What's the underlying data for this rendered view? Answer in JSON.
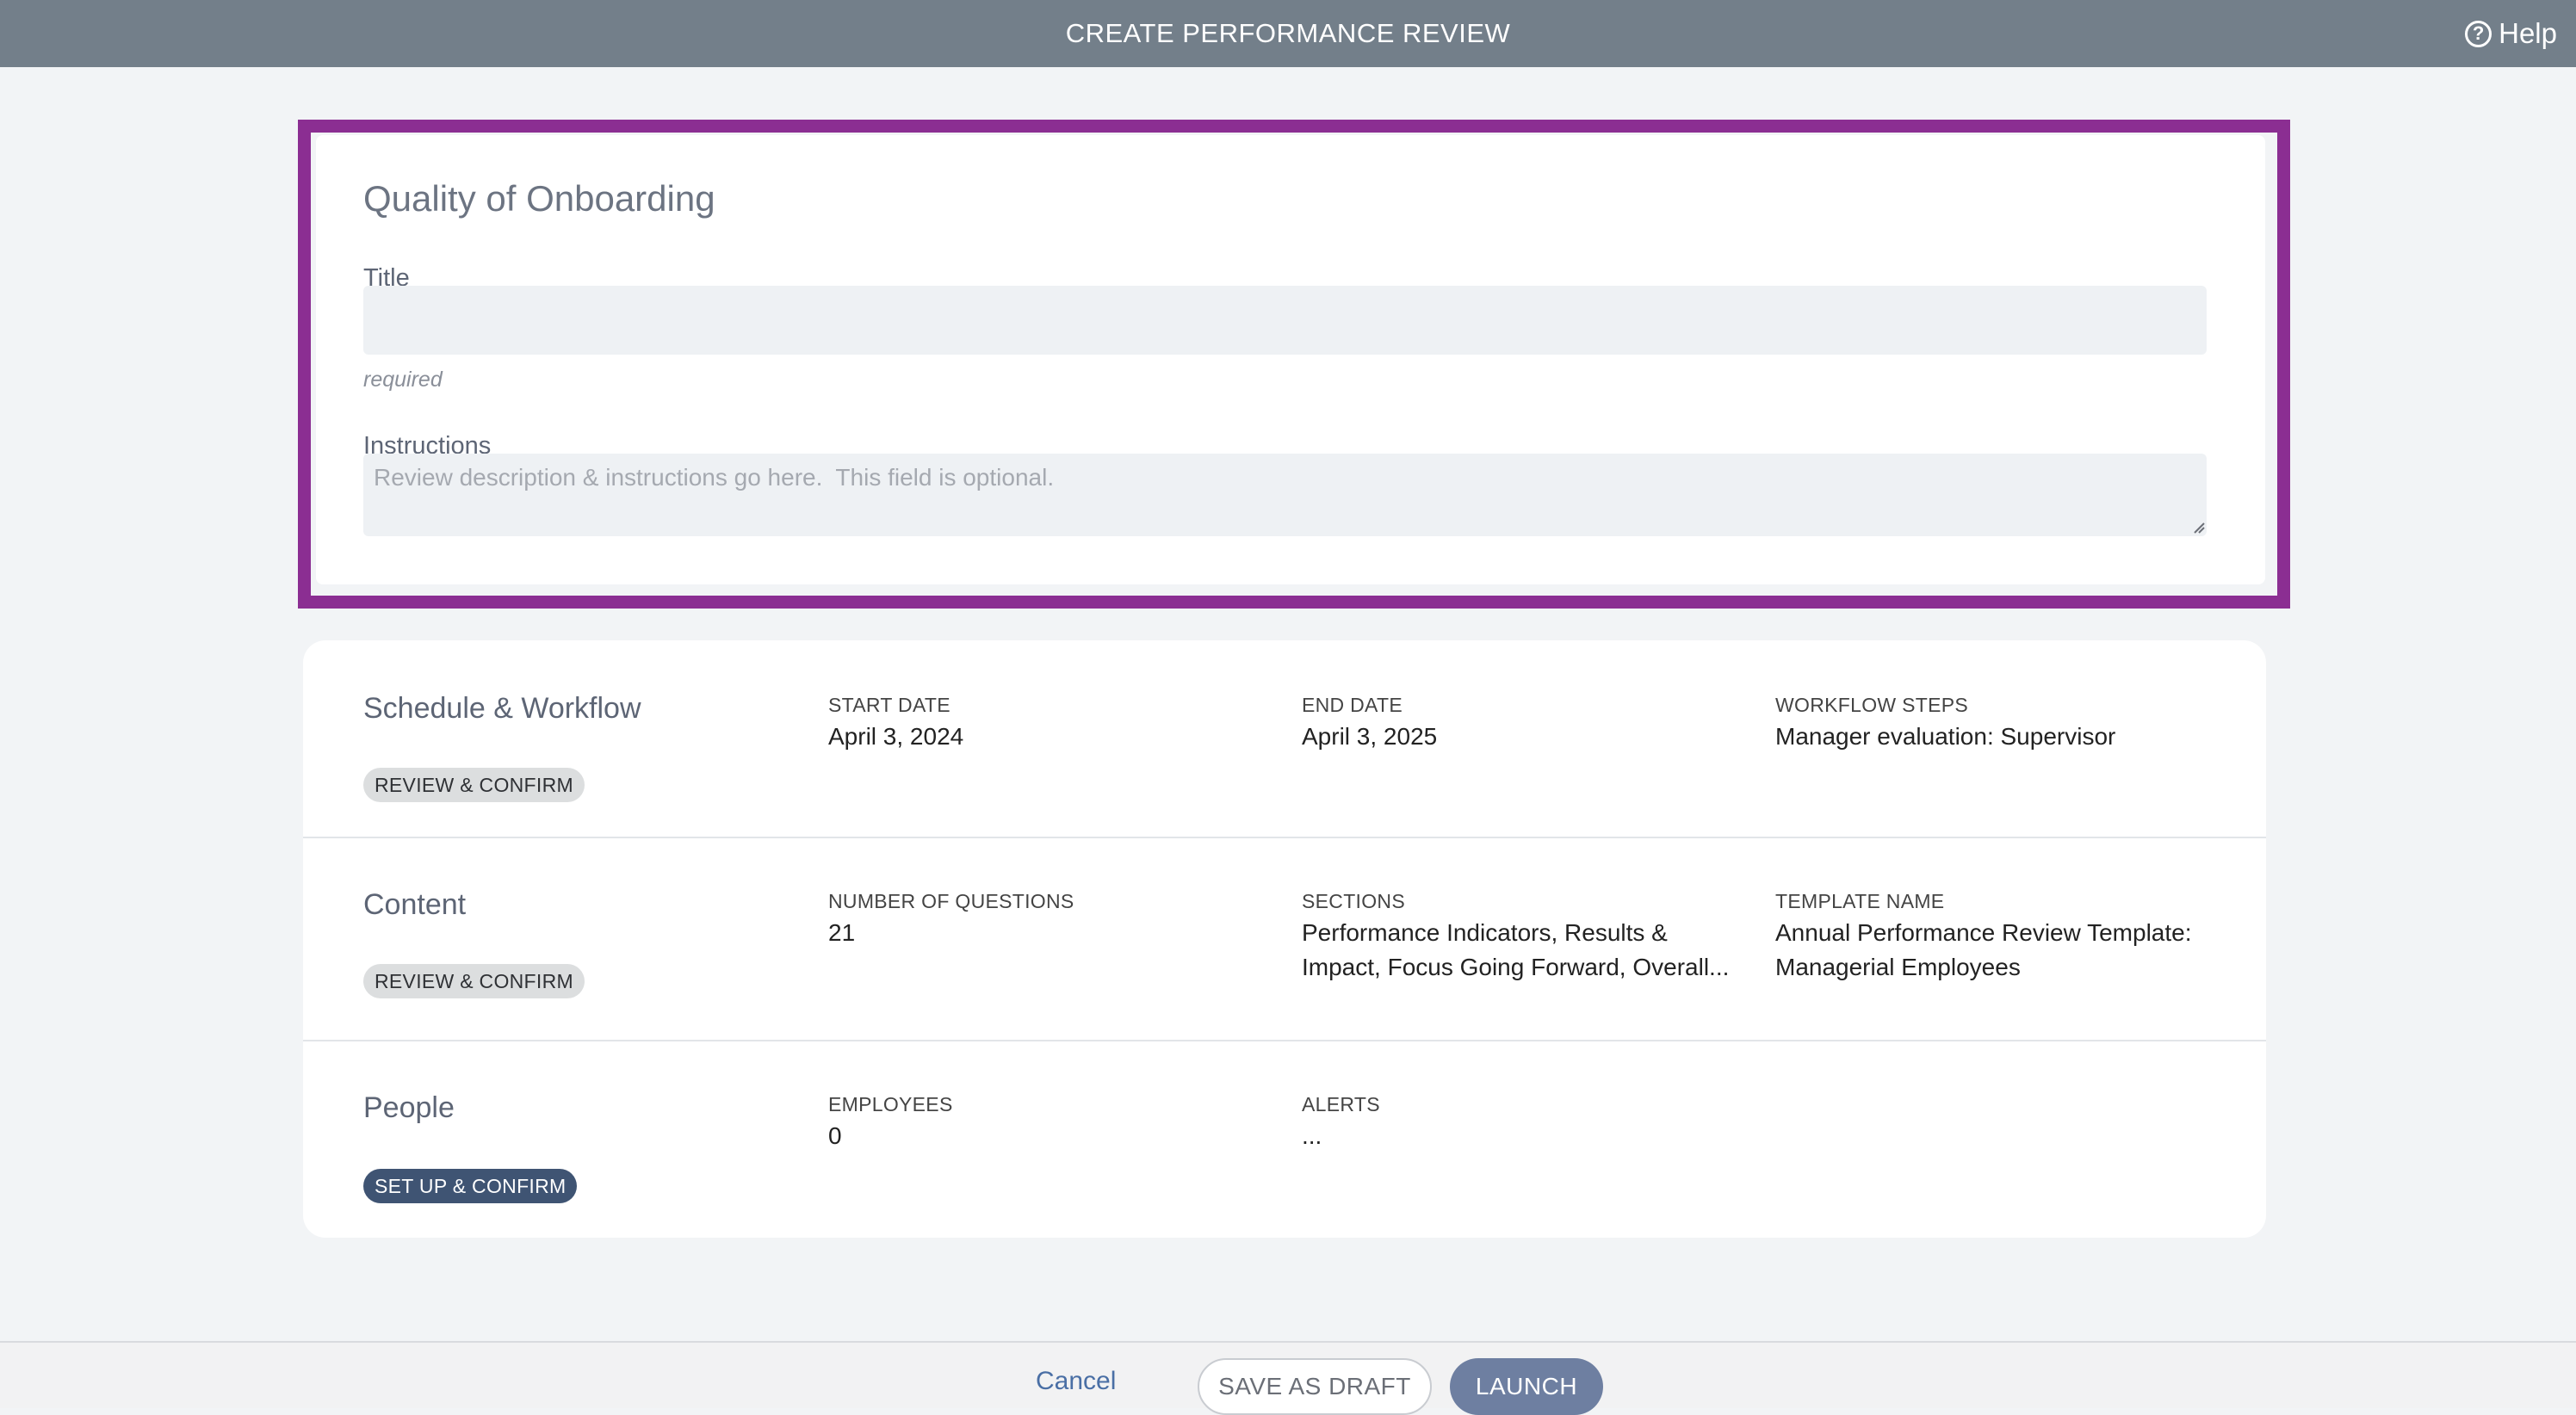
{
  "header": {
    "title": "CREATE PERFORMANCE REVIEW",
    "help_label": "Help",
    "help_icon": "question-circle-icon"
  },
  "review_form": {
    "heading": "Quality of Onboarding",
    "title_label": "Title",
    "title_value": "",
    "title_hint": "required",
    "instructions_label": "Instructions",
    "instructions_placeholder": "Review description & instructions go here.  This field is optional.",
    "highlight_color": "#8b2e92"
  },
  "sections": {
    "schedule": {
      "title": "Schedule & Workflow",
      "action": "REVIEW & CONFIRM",
      "start_date_label": "START DATE",
      "start_date": "April 3, 2024",
      "end_date_label": "END DATE",
      "end_date": "April 3, 2025",
      "workflow_label": "WORKFLOW STEPS",
      "workflow": "Manager evaluation: Supervisor"
    },
    "content": {
      "title": "Content",
      "action": "REVIEW & CONFIRM",
      "questions_label": "NUMBER OF QUESTIONS",
      "questions": "21",
      "sections_label": "SECTIONS",
      "sections_line1": "Performance Indicators, Results &",
      "sections_line2": "Impact, Focus Going Forward, Overall...",
      "template_label": "TEMPLATE NAME",
      "template_line1": "Annual Performance Review Template:",
      "template_line2": "Managerial Employees"
    },
    "people": {
      "title": "People",
      "action": "SET UP & CONFIRM",
      "employees_label": "EMPLOYEES",
      "employees": "0",
      "alerts_label": "ALERTS",
      "alerts": "..."
    }
  },
  "footer": {
    "cancel": "Cancel",
    "save_draft": "SAVE AS DRAFT",
    "launch": "LAUNCH"
  }
}
